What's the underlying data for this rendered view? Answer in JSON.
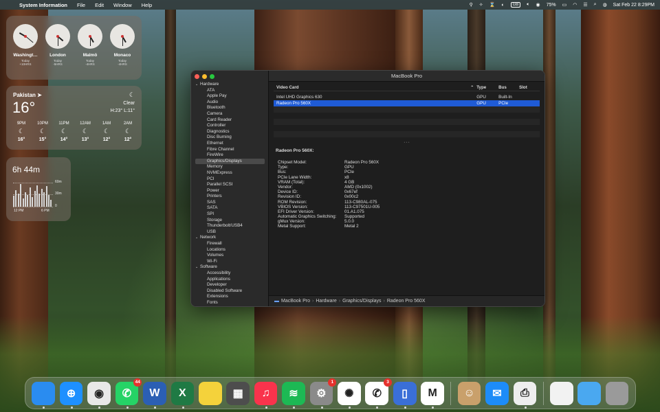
{
  "menubar": {
    "app_name": "System Information",
    "menus": [
      "File",
      "Edit",
      "Window",
      "Help"
    ],
    "battery": "75%",
    "input_source": "GB",
    "datetime": "Sat Feb 22  8:29PM"
  },
  "clocks": [
    {
      "city": "Washingt…",
      "day": "Today",
      "offset": "+10HRS"
    },
    {
      "city": "London",
      "day": "Today",
      "offset": "-5HRS"
    },
    {
      "city": "Malmö",
      "day": "Today",
      "offset": "-4HRS"
    },
    {
      "city": "Monaco",
      "day": "Today",
      "offset": "-4HRS"
    }
  ],
  "weather": {
    "location": "Pakistan",
    "temp": "16°",
    "condition": "Clear",
    "hilo": "H:23° L:11°",
    "hours": [
      {
        "time": "9PM",
        "temp": "16°"
      },
      {
        "time": "10PM",
        "temp": "15°"
      },
      {
        "time": "11PM",
        "temp": "14°"
      },
      {
        "time": "12AM",
        "temp": "13°"
      },
      {
        "time": "1AM",
        "temp": "12°"
      },
      {
        "time": "2AM",
        "temp": "12°"
      }
    ]
  },
  "screen_time": {
    "total": "6h 44m",
    "ylabels": [
      "60m",
      "30m",
      "0"
    ],
    "xlabels": [
      "12 PM",
      "6 PM"
    ],
    "bar_values": [
      0.45,
      0.7,
      0.55,
      0.95,
      0.35,
      0.6,
      0.5,
      0.8,
      0.4,
      0.65,
      0.9,
      0.55,
      0.75,
      0.6,
      0.85,
      0.5,
      0.3
    ]
  },
  "window": {
    "title": "MacBook Pro",
    "sidebar": [
      {
        "label": "Hardware",
        "kind": "cat"
      },
      {
        "label": "ATA",
        "kind": "child"
      },
      {
        "label": "Apple Pay",
        "kind": "child"
      },
      {
        "label": "Audio",
        "kind": "child"
      },
      {
        "label": "Bluetooth",
        "kind": "child"
      },
      {
        "label": "Camera",
        "kind": "child"
      },
      {
        "label": "Card Reader",
        "kind": "child"
      },
      {
        "label": "Controller",
        "kind": "child"
      },
      {
        "label": "Diagnostics",
        "kind": "child"
      },
      {
        "label": "Disc Burning",
        "kind": "child"
      },
      {
        "label": "Ethernet",
        "kind": "child"
      },
      {
        "label": "Fibre Channel",
        "kind": "child"
      },
      {
        "label": "FireWire",
        "kind": "child"
      },
      {
        "label": "Graphics/Displays",
        "kind": "sel"
      },
      {
        "label": "Memory",
        "kind": "child"
      },
      {
        "label": "NVMExpress",
        "kind": "child"
      },
      {
        "label": "PCI",
        "kind": "child"
      },
      {
        "label": "Parallel SCSI",
        "kind": "child"
      },
      {
        "label": "Power",
        "kind": "child"
      },
      {
        "label": "Printers",
        "kind": "child"
      },
      {
        "label": "SAS",
        "kind": "child"
      },
      {
        "label": "SATA",
        "kind": "child"
      },
      {
        "label": "SPI",
        "kind": "child"
      },
      {
        "label": "Storage",
        "kind": "child"
      },
      {
        "label": "Thunderbolt/USB4",
        "kind": "child"
      },
      {
        "label": "USB",
        "kind": "child"
      },
      {
        "label": "Network",
        "kind": "cat"
      },
      {
        "label": "Firewall",
        "kind": "child"
      },
      {
        "label": "Locations",
        "kind": "child"
      },
      {
        "label": "Volumes",
        "kind": "child"
      },
      {
        "label": "Wi-Fi",
        "kind": "child"
      },
      {
        "label": "Software",
        "kind": "cat"
      },
      {
        "label": "Accessibility",
        "kind": "child"
      },
      {
        "label": "Applications",
        "kind": "child"
      },
      {
        "label": "Developer",
        "kind": "child"
      },
      {
        "label": "Disabled Software",
        "kind": "child"
      },
      {
        "label": "Extensions",
        "kind": "child"
      },
      {
        "label": "Fonts",
        "kind": "child"
      }
    ],
    "table": {
      "headers": [
        "Video Card",
        "Type",
        "Bus",
        "Slot"
      ],
      "rows": [
        [
          "Intel UHD Graphics 630",
          "GPU",
          "Built-In",
          ""
        ],
        [
          "Radeon Pro 560X",
          "GPU",
          "PCIe",
          ""
        ]
      ],
      "selected_row": 1
    },
    "detail": {
      "heading": "Radeon Pro 560X:",
      "pairs": [
        [
          "Chipset Model:",
          "Radeon Pro 560X"
        ],
        [
          "Type:",
          "GPU"
        ],
        [
          "Bus:",
          "PCIe"
        ],
        [
          "PCIe Lane Width:",
          "x8"
        ],
        [
          "VRAM (Total):",
          "4 GB"
        ],
        [
          "Vendor:",
          "AMD (0x1002)"
        ],
        [
          "Device ID:",
          "0x67ef"
        ],
        [
          "Revision ID:",
          "0x00c2"
        ],
        [
          "ROM Revision:",
          "113-C980AL-075"
        ],
        [
          "VBIOS Version:",
          "113-C97501U-005"
        ],
        [
          "EFI Driver Version:",
          "01.A1.075"
        ],
        [
          "Automatic Graphics Switching:",
          "Supported"
        ],
        [
          "gMux Version:",
          "5.0.0"
        ],
        [
          "Metal Support:",
          "Metal 2"
        ]
      ]
    },
    "path": [
      "MacBook Pro",
      "Hardware",
      "Graphics/Displays",
      "Radeon Pro 560X"
    ]
  },
  "dock": {
    "apps": [
      {
        "name": "finder-icon",
        "label": "",
        "bg": "#2a8cf0",
        "badge": ""
      },
      {
        "name": "safari-icon",
        "label": "⊕",
        "bg": "#1e90ff",
        "badge": ""
      },
      {
        "name": "chrome-icon",
        "label": "◉",
        "bg": "#e8e8e8",
        "badge": ""
      },
      {
        "name": "whatsapp-icon",
        "label": "✆",
        "bg": "#25d366",
        "badge": "44"
      },
      {
        "name": "word-icon",
        "label": "W",
        "bg": "#2b5fb4",
        "badge": ""
      },
      {
        "name": "excel-icon",
        "label": "X",
        "bg": "#1f7a44",
        "badge": ""
      },
      {
        "name": "notes-icon",
        "label": "",
        "bg": "#f4d23b",
        "badge": ""
      },
      {
        "name": "calculator-icon",
        "label": "▦",
        "bg": "#4d4d4d",
        "badge": ""
      },
      {
        "name": "music-icon",
        "label": "♫",
        "bg": "#f9334c",
        "badge": ""
      },
      {
        "name": "spotify-icon",
        "label": "≋",
        "bg": "#1db954",
        "badge": ""
      },
      {
        "name": "settings-icon",
        "label": "⚙",
        "bg": "#8a8a8a",
        "badge": "1"
      },
      {
        "name": "chatgpt-icon",
        "label": "✺",
        "bg": "#ffffff",
        "badge": ""
      },
      {
        "name": "whatsapp-alt-icon",
        "label": "✆",
        "bg": "#ffffff",
        "badge": "3"
      },
      {
        "name": "iphone-mirroring-icon",
        "label": "▯",
        "bg": "#3a6fd8",
        "badge": ""
      },
      {
        "name": "teams-icon",
        "label": "M",
        "bg": "#ffffff",
        "badge": ""
      },
      {
        "name": "contacts-icon",
        "label": "☺",
        "bg": "#c9a06b",
        "badge": ""
      },
      {
        "name": "mail-icon",
        "label": "✉",
        "bg": "#1d8cf8",
        "badge": ""
      },
      {
        "name": "printer-icon",
        "label": "⎙",
        "bg": "#eeeeee",
        "badge": ""
      },
      {
        "name": "document-icon",
        "label": "",
        "bg": "#f2f2f2",
        "badge": ""
      },
      {
        "name": "downloads-folder-icon",
        "label": "",
        "bg": "#4aa8f0",
        "badge": ""
      },
      {
        "name": "trash-icon",
        "label": "",
        "bg": "#9a9a9a",
        "badge": ""
      }
    ]
  }
}
